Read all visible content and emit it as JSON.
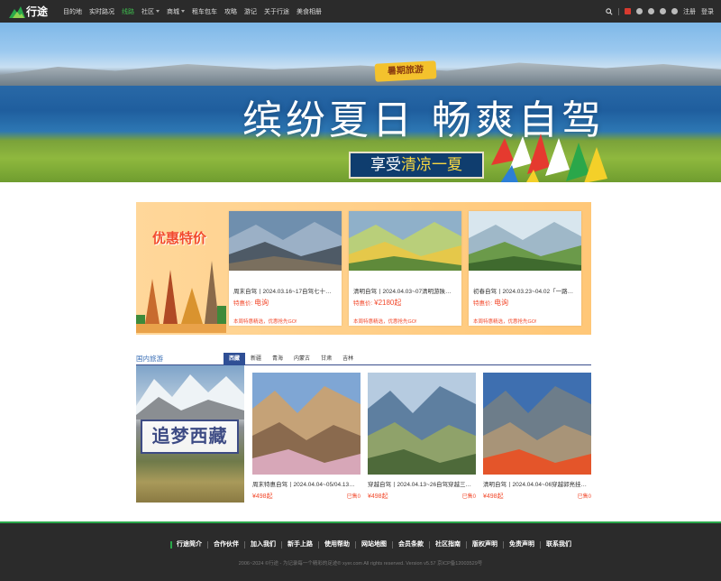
{
  "nav": {
    "logo_text": "行途",
    "items": [
      {
        "label": "目的地",
        "has_caret": false,
        "active": false
      },
      {
        "label": "实时路况",
        "has_caret": false,
        "active": false
      },
      {
        "label": "线路",
        "has_caret": false,
        "active": true
      },
      {
        "label": "社区",
        "has_caret": true,
        "active": false
      },
      {
        "label": "商城",
        "has_caret": true,
        "active": false
      },
      {
        "label": "租车包车",
        "has_caret": false,
        "active": false
      },
      {
        "label": "攻略",
        "has_caret": false,
        "active": false
      },
      {
        "label": "游记",
        "has_caret": false,
        "active": false
      },
      {
        "label": "关于行途",
        "has_caret": false,
        "active": false
      },
      {
        "label": "美食相册",
        "has_caret": false,
        "active": false
      }
    ],
    "register": "注册",
    "login": "登录",
    "icons": [
      "search-icon",
      "weibo-icon",
      "qq-icon",
      "wechat-icon",
      "weibo2-icon",
      "user-icon"
    ]
  },
  "banner": {
    "sign": "暑期旅游",
    "title": "缤纷夏日 畅爽自驾",
    "sub_prefix": "享受",
    "sub_highlight": "清凉一夏",
    "slides": 5,
    "active_slide": 1
  },
  "deals": {
    "title": "优惠特价",
    "cards": [
      {
        "title": "周末自驾丨2024.03.16~17自驾七十…",
        "price_label": "特惠价:",
        "price": "电询",
        "note": "本周特惠精选，优惠抢先GO!"
      },
      {
        "title": "清明自驾丨2024.04.03~07清明游陕…",
        "price_label": "特惠价:",
        "price": "¥2180起",
        "note": "本周特惠精选，优惠抢先GO!"
      },
      {
        "title": "初春自驾丨2024.03.23~04.02「一路…",
        "price_label": "特惠价:",
        "price": "电询",
        "note": "本周特惠精选，优惠抢先GO!"
      }
    ]
  },
  "domestic": {
    "title": "国内旅游",
    "tabs": [
      {
        "label": "西藏",
        "active": true
      },
      {
        "label": "新疆",
        "active": false
      },
      {
        "label": "青海",
        "active": false
      },
      {
        "label": "内蒙古",
        "active": false
      },
      {
        "label": "甘肃",
        "active": false
      },
      {
        "label": "吉林",
        "active": false
      }
    ],
    "feature": "追梦西藏",
    "cards": [
      {
        "title": "周末特惠自驾丨2024.04.04~05/04.13…",
        "price": "¥498起",
        "sold": "已售0"
      },
      {
        "title": "穿越自驾丨2024.04.13~26自驾穿越三…",
        "price": "¥498起",
        "sold": "已售0"
      },
      {
        "title": "清明自驾丨2024.04.04~06穿越郭亮挂…",
        "price": "¥498起",
        "sold": "已售0"
      }
    ]
  },
  "footer": {
    "links": [
      "行途简介",
      "合作伙伴",
      "加入我们",
      "新手上路",
      "使用帮助",
      "网站地图",
      "会员条款",
      "社区指南",
      "版权声明",
      "免责声明",
      "联系我们"
    ],
    "copyright": "2006~2024 ©行途 - 为记录每一个精彩的足迹® xyer.com All rights reserved. Version v5.57 京ICP备12003529号"
  }
}
